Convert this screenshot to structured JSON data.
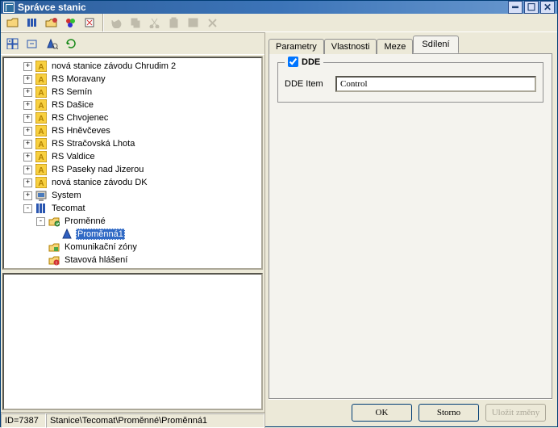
{
  "title": "Správce stanic",
  "tree": [
    {
      "depth": 1,
      "exp": "+",
      "icon": "A",
      "label": "nová stanice závodu Chrudim 2"
    },
    {
      "depth": 1,
      "exp": "+",
      "icon": "A",
      "label": "RS Moravany"
    },
    {
      "depth": 1,
      "exp": "+",
      "icon": "A",
      "label": "RS Semín"
    },
    {
      "depth": 1,
      "exp": "+",
      "icon": "A",
      "label": "RS Dašice"
    },
    {
      "depth": 1,
      "exp": "+",
      "icon": "A",
      "label": "RS Chvojenec"
    },
    {
      "depth": 1,
      "exp": "+",
      "icon": "A",
      "label": "RS Hněvčeves"
    },
    {
      "depth": 1,
      "exp": "+",
      "icon": "A",
      "label": "RS Stračovská Lhota"
    },
    {
      "depth": 1,
      "exp": "+",
      "icon": "A",
      "label": "RS Valdice"
    },
    {
      "depth": 1,
      "exp": "+",
      "icon": "A",
      "label": "RS Paseky nad Jizerou"
    },
    {
      "depth": 1,
      "exp": "+",
      "icon": "A",
      "label": "nová stanice závodu DK"
    },
    {
      "depth": 1,
      "exp": "+",
      "icon": "sys",
      "label": "System"
    },
    {
      "depth": 1,
      "exp": "-",
      "icon": "tec",
      "label": "Tecomat"
    },
    {
      "depth": 2,
      "exp": "-",
      "icon": "folder",
      "label": "Proměnné"
    },
    {
      "depth": 3,
      "exp": "",
      "icon": "var",
      "label": "Proměnná1",
      "selected": true
    },
    {
      "depth": 2,
      "exp": "",
      "icon": "zone",
      "label": "Komunikační zóny"
    },
    {
      "depth": 2,
      "exp": "",
      "icon": "alert",
      "label": "Stavová hlášení"
    }
  ],
  "tabs": {
    "parametry": "Parametry",
    "vlastnosti": "Vlastnosti",
    "meze": "Meze",
    "sdileni": "Sdílení"
  },
  "activeTab": "sdileni",
  "dde": {
    "legend": "DDE",
    "checked": true,
    "item_label": "DDE Item",
    "item_value": "Control"
  },
  "buttons": {
    "ok": "OK",
    "storno": "Storno",
    "ulozit": "Uložit změny"
  },
  "status": {
    "id": "ID=7387",
    "path": "Stanice\\Tecomat\\Proměnné\\Proměnná1"
  }
}
